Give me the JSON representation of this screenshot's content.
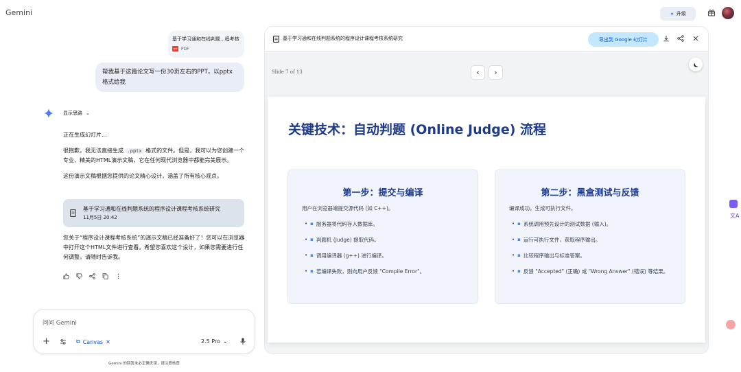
{
  "app": {
    "brand": "Gemini",
    "upgrade_label": "升级"
  },
  "chat": {
    "file": {
      "name": "基于学习通和在线判题...程考核",
      "type": "PDF"
    },
    "user_message": "帮我基于这篇论文写一份30页左右的PPT，以pptx格式给我",
    "thinking_label": "显示思路",
    "status": "正在生成幻灯片...",
    "reply_p1_before": "很抱歉，我无法直接生成 ",
    "reply_p1_code": ".pptx",
    "reply_p1_after": " 格式的文件。但是，我可以为您创建一个专业、精美的HTML演示文稿，它在任何现代浏览器中都能完美展示。",
    "reply_p2": "这份演示文稿根据您提供的论文精心设计，涵盖了所有核心观点。",
    "doc_card": {
      "title": "基于学习通和在线判题系统的程序设计课程考核系统研究",
      "time": "11月5日 20:42"
    },
    "reply_p3": "您关于“程序设计课程考核系统”的演示文稿已经准备好了！您可以在浏览器中打开这个HTML文件进行查看。希望您喜欢这个设计，如果您需要进行任何调整，请随时告诉我。"
  },
  "composer": {
    "placeholder": "问问 Gemini",
    "canvas_label": "Canvas",
    "model": "2.5 Pro",
    "disclaimer": "Gemini 的回答未必正确无误，请注意核查"
  },
  "panel": {
    "title": "基于学习通和在线判题系统的程序设计课程考核系统研究",
    "export_label": "导出到 Google 幻灯片",
    "slide_counter": "Slide 7 of 13"
  },
  "slide": {
    "title": "关键技术：自动判题 (Online Judge) 流程",
    "left": {
      "title": "第一步：提交与编译",
      "subtitle": "用户在浏览器端提交源代码 (如 C++)。",
      "items": [
        "服务器将代码存入数据库。",
        "判题机 (Judge) 提取代码。",
        "调用编译器 (g++) 进行编译。",
        "若编译失败，则向用户反馈 \"Compile Error\"。"
      ]
    },
    "right": {
      "title": "第二步：黑盒测试与反馈",
      "subtitle": "编译成功，生成可执行文件。",
      "items": [
        "系统调用预先设计的测试数据 (输入)。",
        "运行可执行文件，获取程序输出。",
        "比较程序输出与标准答案。",
        "反馈 \"Accepted\" (正确) 或 \"Wrong Answer\" (错误) 等结果。"
      ]
    }
  },
  "icons": {
    "gemini_star": "gemini-star-icon",
    "accent": "#0b57d0",
    "slide_title_color": "#1e3a8a"
  }
}
